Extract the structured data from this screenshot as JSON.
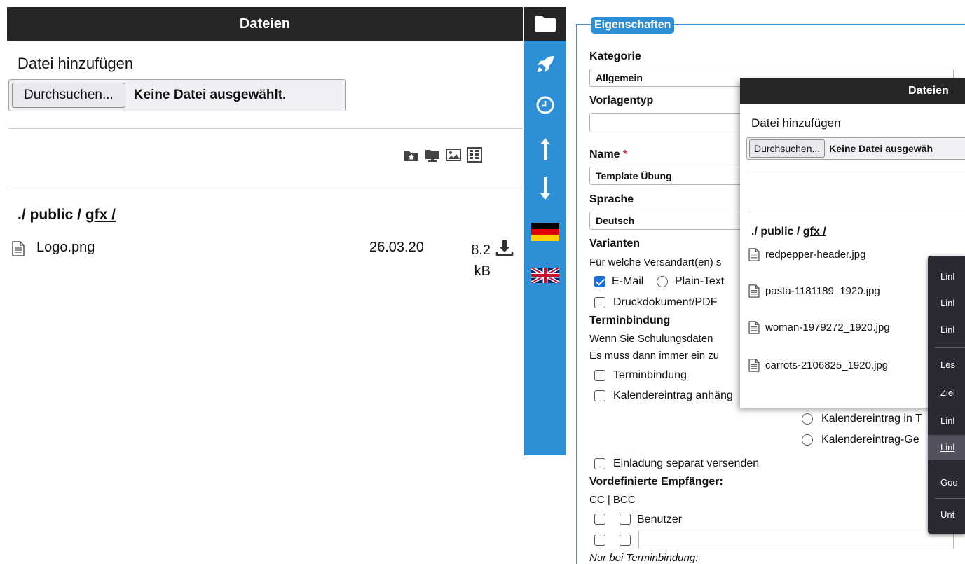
{
  "left_panel": {
    "title": "Dateien",
    "add_label": "Datei hinzufügen",
    "browse_label": "Durchsuchen...",
    "no_file_label": "Keine Datei ausgewählt.",
    "path_prefix": "./ public / ",
    "path_link": "gfx /",
    "files": [
      {
        "name": "Logo.png",
        "date": "26.03.20",
        "size": "8.2 kB"
      }
    ],
    "toolbar_icons": [
      "home-folder-icon",
      "server-folder-icon",
      "image-icon",
      "grid-icon"
    ]
  },
  "sidebar": {
    "icons": [
      "folder-icon",
      "rocket-icon",
      "clock-icon",
      "arrow-up-icon",
      "arrow-down-icon",
      "german-flag-icon",
      "uk-flag-icon"
    ],
    "colors": {
      "background": "#2d8fd5",
      "header": "#262626"
    }
  },
  "properties": {
    "legend": "Eigenschaften",
    "kategorie_label": "Kategorie",
    "kategorie_value": "Allgemein",
    "vorlagentyp_label": "Vorlagentyp",
    "vorlagentyp_value": "",
    "name_label": "Name",
    "name_required": "*",
    "name_value": "Template Übung",
    "sprache_label": "Sprache",
    "sprache_value": "Deutsch",
    "varianten_label": "Varianten",
    "varianten_text": "Für welche Versandart(en) s",
    "email_label": "E-Mail",
    "plaintext_label": "Plain-Text",
    "druck_label": "Druckdokument/PDF",
    "terminbindung_label": "Terminbindung",
    "termin_text1": "Wenn Sie Schulungsdaten",
    "termin_text2": "Es muss dann immer ein zu",
    "terminbindung_cb": "Terminbindung",
    "kalender_cb": "Kalendereintrag anhäng",
    "kalender_radio1": "Kalendereintrag in T",
    "kalender_radio2": "Kalendereintrag-Ge",
    "einladung_cb": "Einladung separat versenden",
    "empfaenger_label": "Vordefinierte Empfänger:",
    "cc_bcc": "CC | BCC",
    "benutzer_label": "Benutzer",
    "nur_termin": "Nur bei Terminbindung:"
  },
  "overlay": {
    "title": "Dateien",
    "add_label": "Datei hinzufügen",
    "browse_label": "Durchsuchen...",
    "no_file_label": "Keine Datei ausgewäh",
    "path_prefix": "./ public / ",
    "path_link": "gfx /",
    "files": [
      "redpepper-header.jpg",
      "pasta-1181189_1920.jpg",
      "woman-1979272_1920.jpg",
      "carrots-2106825_1920.jpg"
    ]
  },
  "context_menu": {
    "items": [
      "Linl",
      "Linl",
      "Linl",
      "Les",
      "Ziel",
      "Linl",
      "Linl",
      "Goo",
      "Unt"
    ]
  }
}
